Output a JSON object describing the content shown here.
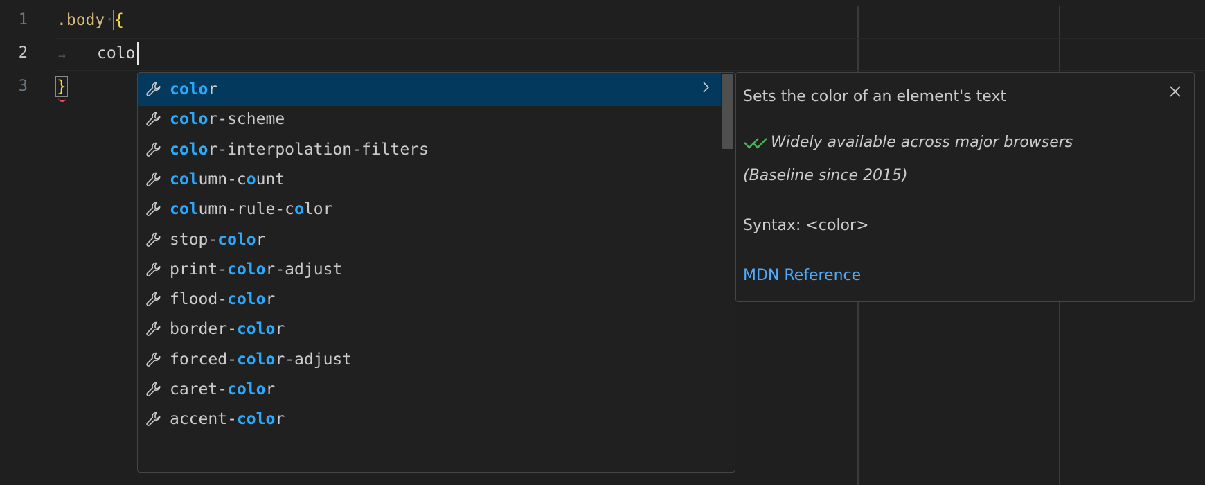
{
  "editor": {
    "line_numbers": [
      "1",
      "2",
      "3"
    ],
    "line1": {
      "selector": ".body",
      "open_brace": "{"
    },
    "line2": {
      "typed": "colo"
    },
    "line3": {
      "close_brace": "}"
    }
  },
  "suggest": {
    "selected_index": 0,
    "items": [
      {
        "pre": "",
        "hl1": "colo",
        "mid": "r",
        "hl2": "",
        "post": ""
      },
      {
        "pre": "",
        "hl1": "colo",
        "mid": "r-scheme",
        "hl2": "",
        "post": ""
      },
      {
        "pre": "",
        "hl1": "colo",
        "mid": "r-interpolation-filters",
        "hl2": "",
        "post": ""
      },
      {
        "pre": "",
        "hl1": "col",
        "mid": "umn-c",
        "hl2": "o",
        "post": "unt"
      },
      {
        "pre": "",
        "hl1": "col",
        "mid": "umn-rule-c",
        "hl2": "o",
        "post": "lor"
      },
      {
        "pre": "stop-",
        "hl1": "colo",
        "mid": "r",
        "hl2": "",
        "post": ""
      },
      {
        "pre": "print-",
        "hl1": "colo",
        "mid": "r-adjust",
        "hl2": "",
        "post": ""
      },
      {
        "pre": "flood-",
        "hl1": "colo",
        "mid": "r",
        "hl2": "",
        "post": ""
      },
      {
        "pre": "border-",
        "hl1": "colo",
        "mid": "r",
        "hl2": "",
        "post": ""
      },
      {
        "pre": "forced-",
        "hl1": "colo",
        "mid": "r-adjust",
        "hl2": "",
        "post": ""
      },
      {
        "pre": "caret-",
        "hl1": "colo",
        "mid": "r",
        "hl2": "",
        "post": ""
      },
      {
        "pre": "accent-",
        "hl1": "colo",
        "mid": "r",
        "hl2": "",
        "post": ""
      }
    ],
    "item_icon": "wrench-icon"
  },
  "details": {
    "title": "Sets the color of an element's text",
    "baseline_line1": "Widely available across major browsers",
    "baseline_line2": "(Baseline since 2015)",
    "syntax": "Syntax: <color>",
    "link_text": "MDN Reference",
    "baseline_icon": "double-check-icon",
    "close_icon": "close-icon"
  },
  "colors": {
    "background": "#1f1f1f",
    "selected_row": "#04395e",
    "match_highlight": "#2aaaff",
    "link": "#4daafc",
    "baseline_check": "#3fb950"
  }
}
